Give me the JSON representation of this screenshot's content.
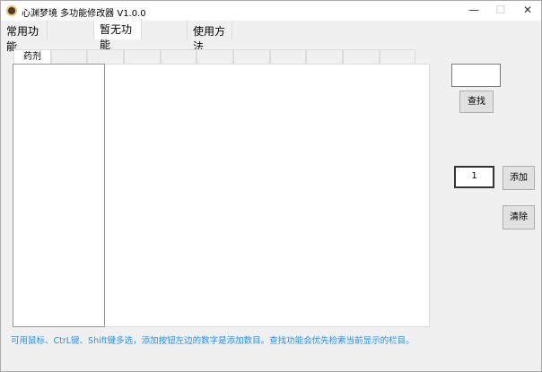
{
  "window": {
    "title": "心渊梦境 多功能修改器 V1.0.0",
    "minimize": "—",
    "maximize": "☐",
    "close": "✕"
  },
  "tabs": [
    {
      "label": "常用功能"
    },
    {
      "label": ""
    },
    {
      "label": "暂无功能"
    },
    {
      "label": ""
    },
    {
      "label": "使用方法"
    }
  ],
  "inner_tabs": [
    {
      "label": "药剂"
    }
  ],
  "search": {
    "value": "",
    "button": "查找"
  },
  "add": {
    "value": "1",
    "button": "添加"
  },
  "clear": {
    "button": "清除"
  },
  "hint": "可用鼠标、CtrL键、Shift键多选，添加按钮左边的数字是添加数目。查找功能会优先检索当前显示的栏目。"
}
